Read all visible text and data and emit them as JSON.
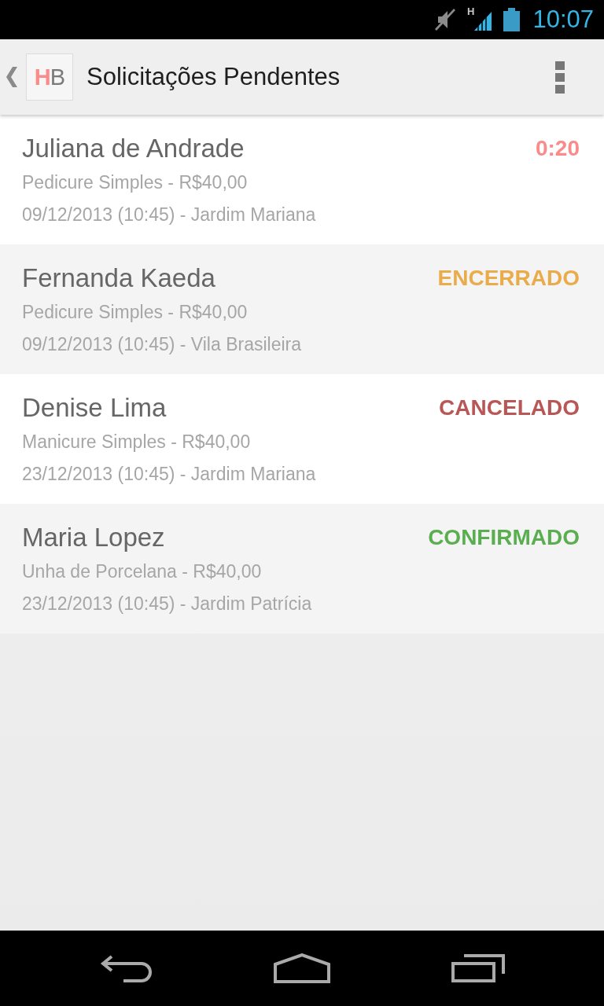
{
  "status_bar": {
    "network": "H",
    "time": "10:07"
  },
  "action_bar": {
    "logo": {
      "accent": "H",
      "rest": "B"
    },
    "title": "Solicitações Pendentes"
  },
  "requests": [
    {
      "name": "Juliana de Andrade",
      "service": "Pedicure Simples - R$40,00",
      "details": "09/12/2013 (10:45) - Jardim Mariana",
      "status": "0:20",
      "color": "#fb8a8a"
    },
    {
      "name": "Fernanda Kaeda",
      "service": "Pedicure Simples - R$40,00",
      "details": "09/12/2013 (10:45) - Vila Brasileira",
      "status": "ENCERRADO",
      "color": "#eaab4b"
    },
    {
      "name": "Denise Lima",
      "service": "Manicure Simples - R$40,00",
      "details": "23/12/2013 (10:45) - Jardim Mariana",
      "status": "CANCELADO",
      "color": "#b95757"
    },
    {
      "name": "Maria Lopez",
      "service": "Unha de Porcelana - R$40,00",
      "details": "23/12/2013 (10:45) - Jardim Patrícia",
      "status": "CONFIRMADO",
      "color": "#5aae50"
    }
  ]
}
